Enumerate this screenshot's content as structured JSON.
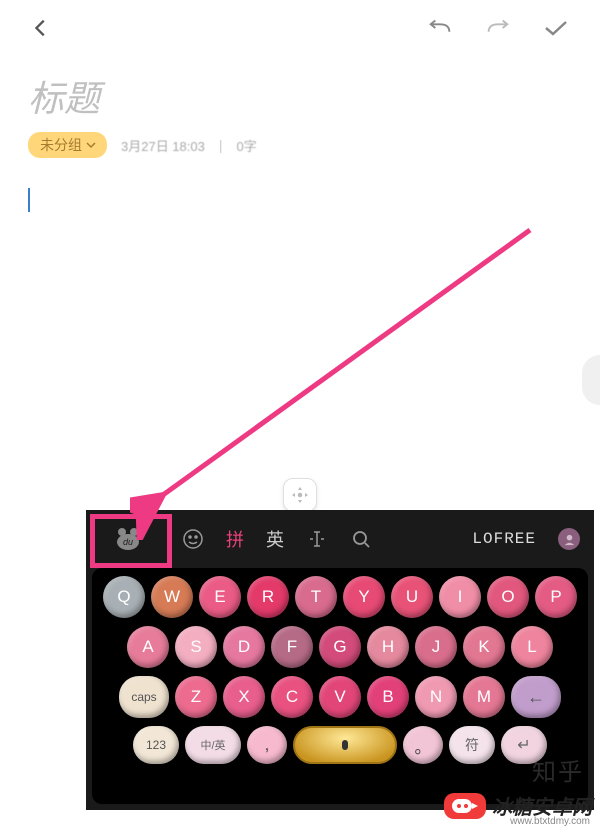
{
  "header": {
    "back": "back",
    "undo": "undo",
    "redo": "redo",
    "confirm": "confirm"
  },
  "note": {
    "title_placeholder": "标题",
    "category": "未分组",
    "timestamp": "3月27日 18:03",
    "word_count": "0字"
  },
  "keyboard": {
    "toolbar": {
      "logo": "du",
      "emoji": "☺",
      "pinyin": "拼",
      "english": "英",
      "cursor": "⇱",
      "search": "⌕",
      "brand": "LOFREE"
    },
    "rows": {
      "r1": [
        "Q",
        "W",
        "E",
        "R",
        "T",
        "Y",
        "U",
        "I",
        "O",
        "P"
      ],
      "r2": [
        "A",
        "S",
        "D",
        "F",
        "G",
        "H",
        "J",
        "K",
        "L"
      ],
      "r3": {
        "caps": "caps",
        "keys": [
          "Z",
          "X",
          "C",
          "V",
          "B",
          "N",
          "M"
        ],
        "del": "←"
      },
      "r4": {
        "num": "123",
        "lang": "中/英",
        "comma": ",",
        "period": "。",
        "sym": "符",
        "enter": "↵"
      }
    }
  },
  "colors": {
    "r1": [
      "#a8b0b5",
      "#d67b56",
      "#ea5b85",
      "#e33a6a",
      "#d86b8e",
      "#e74a75",
      "#e85277",
      "#f18ea7",
      "#e2577d",
      "#e45b84"
    ],
    "r2": [
      "#e77c9a",
      "#f3aec1",
      "#e678a0",
      "#b56a86",
      "#d24b7a",
      "#e5899e",
      "#d96e8c",
      "#e27792",
      "#ee849d"
    ],
    "r3caps": "#efe2cf",
    "r3": [
      "#ec6b8f",
      "#e85e8c",
      "#e85180",
      "#e24679",
      "#e24078",
      "#f09ab2",
      "#e47793"
    ],
    "r3del": "#c19dcc",
    "r4num": "#f2e7d6",
    "r4lang": "#f3dce6",
    "r4comma": "#f7b9ce",
    "r4period": "#f2c5d6",
    "r4sym": "#f5e3ec",
    "r4enter": "#f1d4e0"
  },
  "watermark": {
    "text": "冰糖安卓网",
    "url": "www.btxtdmy.com",
    "zh_bg": "知乎"
  }
}
